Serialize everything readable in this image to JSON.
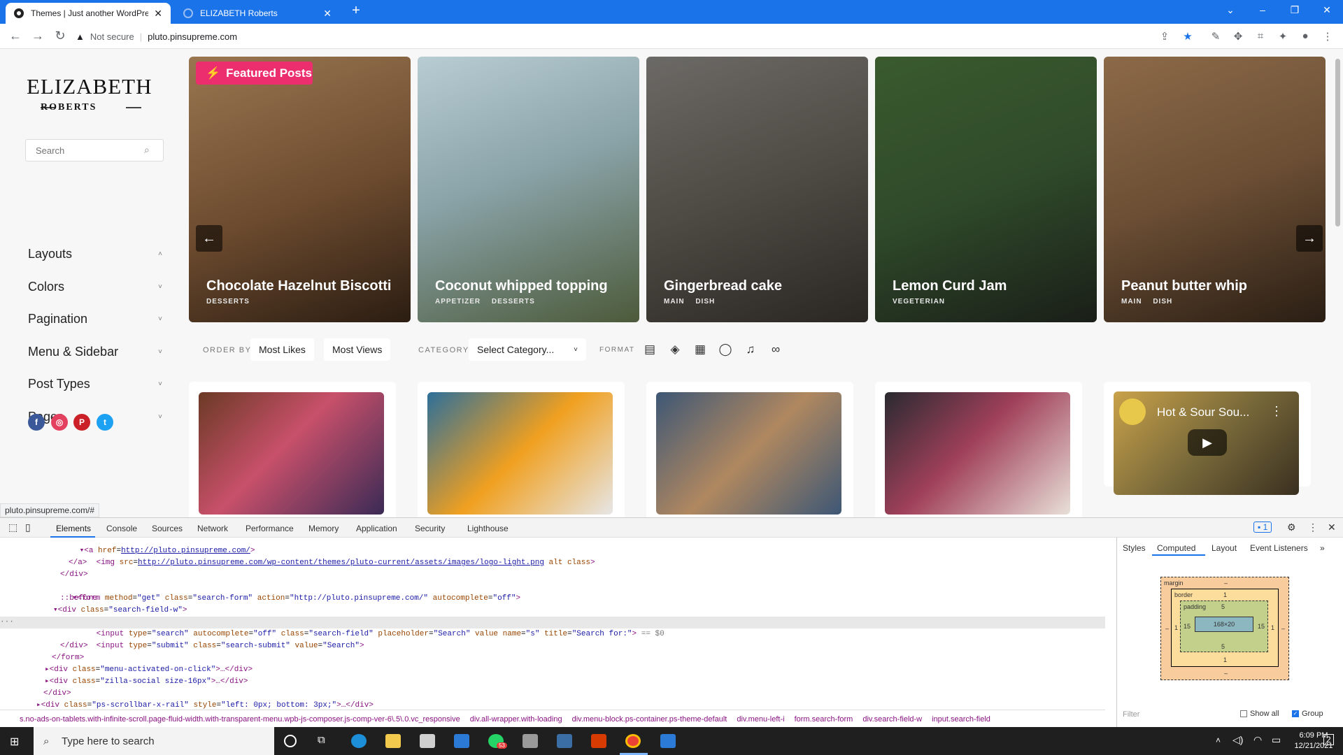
{
  "browser": {
    "tabs": [
      {
        "title": "Themes | Just another WordPress",
        "active": true
      },
      {
        "title": "ELIZABETH Roberts",
        "active": false
      }
    ],
    "new_tab": "+",
    "security": "Not secure",
    "url": "pluto.pinsupreme.com"
  },
  "site": {
    "logo_main": "ELIZABETH",
    "logo_sub": "ROBERTS",
    "search_placeholder": "Search",
    "menu": [
      {
        "label": "Layouts",
        "chevron": "˄"
      },
      {
        "label": "Colors",
        "chevron": "˅"
      },
      {
        "label": "Pagination",
        "chevron": "˅"
      },
      {
        "label": "Menu & Sidebar",
        "chevron": "˅"
      },
      {
        "label": "Post Types",
        "chevron": "˅"
      },
      {
        "label": "Pages",
        "chevron": "˅"
      }
    ],
    "social": [
      {
        "name": "facebook-icon",
        "color": "#3b5998",
        "glyph": "f"
      },
      {
        "name": "instagram-icon",
        "color": "#e4405f",
        "glyph": "◎"
      },
      {
        "name": "pinterest-icon",
        "color": "#cb2027",
        "glyph": "P"
      },
      {
        "name": "twitter-icon",
        "color": "#1da1f2",
        "glyph": "t"
      }
    ],
    "featured_label": "Featured Posts",
    "featured": [
      {
        "title": "Chocolate Hazelnut Biscotti",
        "cats": "DESSERTS",
        "bg": "#7a5a3a"
      },
      {
        "title": "Coconut whipped topping",
        "cats": "APPETIZER DESSERTS",
        "bg": "#8aa3a8"
      },
      {
        "title": "Gingerbread cake",
        "cats": "MAIN DISH",
        "bg": "#4e4a44"
      },
      {
        "title": "Lemon Curd Jam",
        "cats": "VEGETERIAN",
        "bg": "#2f4a2a"
      },
      {
        "title": "Peanut butter whip",
        "cats": "MAIN DISH",
        "bg": "#6b4e34"
      }
    ],
    "filters": {
      "order_by": "ORDER BY",
      "most_likes": "Most Likes",
      "most_views": "Most Views",
      "category": "CATEGORY",
      "select_category": "Select Category...",
      "format": "FORMAT"
    },
    "posts": [
      {
        "bg": "#8b5a3c",
        "video_title": ""
      },
      {
        "bg": "#4a86b0",
        "video_title": ""
      },
      {
        "bg": "#3d5775",
        "video_title": ""
      },
      {
        "bg": "#3a3230",
        "video_title": ""
      },
      {
        "bg": "#a08a5a",
        "video_title": "Hot & Sour Sou..."
      }
    ],
    "status_link": "pluto.pinsupreme.com/#"
  },
  "devtools": {
    "tabs": [
      "Elements",
      "Console",
      "Sources",
      "Network",
      "Performance",
      "Memory",
      "Application",
      "Security",
      "Lighthouse"
    ],
    "issues_count": "1",
    "right_tabs": [
      "Styles",
      "Computed",
      "Layout",
      "Event Listeners",
      "»"
    ],
    "lines": {
      "l1_href": "http://pluto.pinsupreme.com/",
      "l2_src": "http://pluto.pinsupreme.com/wp-content/themes/pluto-current/assets/images/logo-light.png",
      "l4_action": "http://pluto.pinsupreme.com/"
    },
    "crumbs": [
      "s.no-ads-on-tablets.with-infinite-scroll.page-fluid-width.with-transparent-menu.wpb-js-composer.js-comp-ver-6\\.5\\.0.vc_responsive",
      "div.all-wrapper.with-loading",
      "div.menu-block.ps-container.ps-theme-default",
      "div.menu-left-i",
      "form.search-form",
      "div.search-field-w",
      "input.search-field"
    ],
    "box": {
      "margin": "margin",
      "margin_val": "–",
      "border": "border",
      "border_val": "1",
      "padding": "padding",
      "padding_val": "5",
      "size": "168×20",
      "side": "15"
    },
    "filter": "Filter",
    "show_all": "Show all",
    "group": "Group"
  },
  "taskbar": {
    "search": "Type here to search",
    "time": "6:09 PM",
    "date": "12/21/2021",
    "notif": "2",
    "badge": "53"
  }
}
